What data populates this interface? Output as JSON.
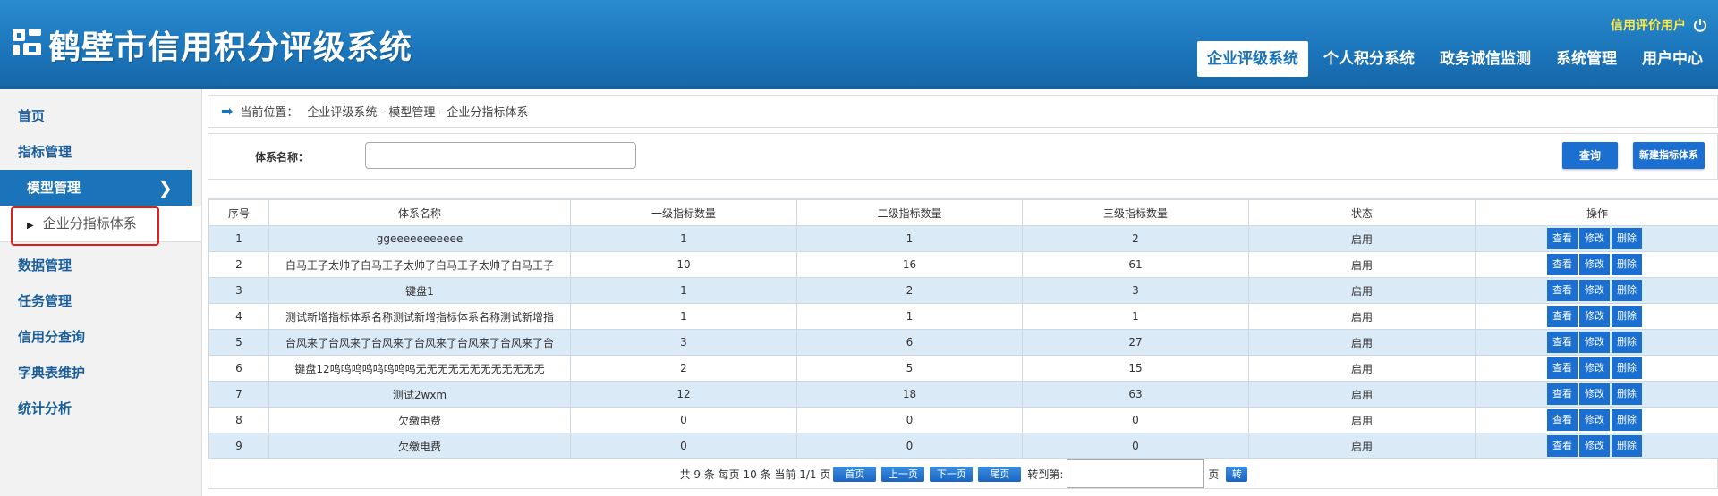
{
  "header": {
    "title": "鹤壁市信用积分评级系统",
    "user": "信用评价用户",
    "nav": [
      "企业评级系统",
      "个人积分系统",
      "政务诚信监测",
      "系统管理",
      "用户中心"
    ],
    "active_nav": "企业评级系统"
  },
  "sidebar": {
    "items": [
      "首页",
      "指标管理",
      "模型管理",
      "数据管理",
      "任务管理",
      "信用分查询",
      "字典表维护",
      "统计分析"
    ],
    "sub_item": "企业分指标体系",
    "active": "模型管理"
  },
  "breadcrumb": {
    "label": "当前位置：",
    "path": "企业评级系统 - 模型管理 - 企业分指标体系"
  },
  "search": {
    "label": "体系名称：",
    "value": "",
    "query_button": "查询",
    "new_button": "新建指标体系"
  },
  "table": {
    "headers": [
      "序号",
      "体系名称",
      "一级指标数量",
      "二级指标数量",
      "三级指标数量",
      "状态",
      "操作"
    ],
    "actions": [
      "查看",
      "修改",
      "删除"
    ],
    "rows": [
      [
        "1",
        "ggeeeeeeeeeee",
        "1",
        "1",
        "2",
        "启用"
      ],
      [
        "2",
        "白马王子太帅了白马王子太帅了白马王子太帅了白马王子",
        "10",
        "16",
        "61",
        "启用"
      ],
      [
        "3",
        "键盘1",
        "1",
        "2",
        "3",
        "启用"
      ],
      [
        "4",
        "测试新增指标体系名称测试新增指标体系名称测试新增指",
        "1",
        "1",
        "1",
        "启用"
      ],
      [
        "5",
        "台风来了台风来了台风来了台风来了台风来了台风来了台",
        "3",
        "6",
        "27",
        "启用"
      ],
      [
        "6",
        "键盘12呜呜呜呜呜呜呜呜无无无无无无无无无无无无",
        "2",
        "5",
        "15",
        "启用"
      ],
      [
        "7",
        "测试2wxm",
        "12",
        "18",
        "63",
        "启用"
      ],
      [
        "8",
        "欠缴电费",
        "0",
        "0",
        "0",
        "启用"
      ],
      [
        "9",
        "欠缴电费",
        "0",
        "0",
        "0",
        "启用"
      ]
    ]
  },
  "pager": {
    "summary": "共 9 条 每页 10 条 当前 1/1 页",
    "first": "首页",
    "prev": "上一页",
    "next": "下一页",
    "last": "尾页",
    "goto_label": "转到第:",
    "page_unit": "页",
    "go": "转"
  },
  "colors": {
    "header_blue": "#1b74b9",
    "button_blue": "#1a6fd0",
    "user_yellow": "#ffe94a",
    "highlight_red": "#e21b1b",
    "row_stripe": "#dbeaf7"
  }
}
